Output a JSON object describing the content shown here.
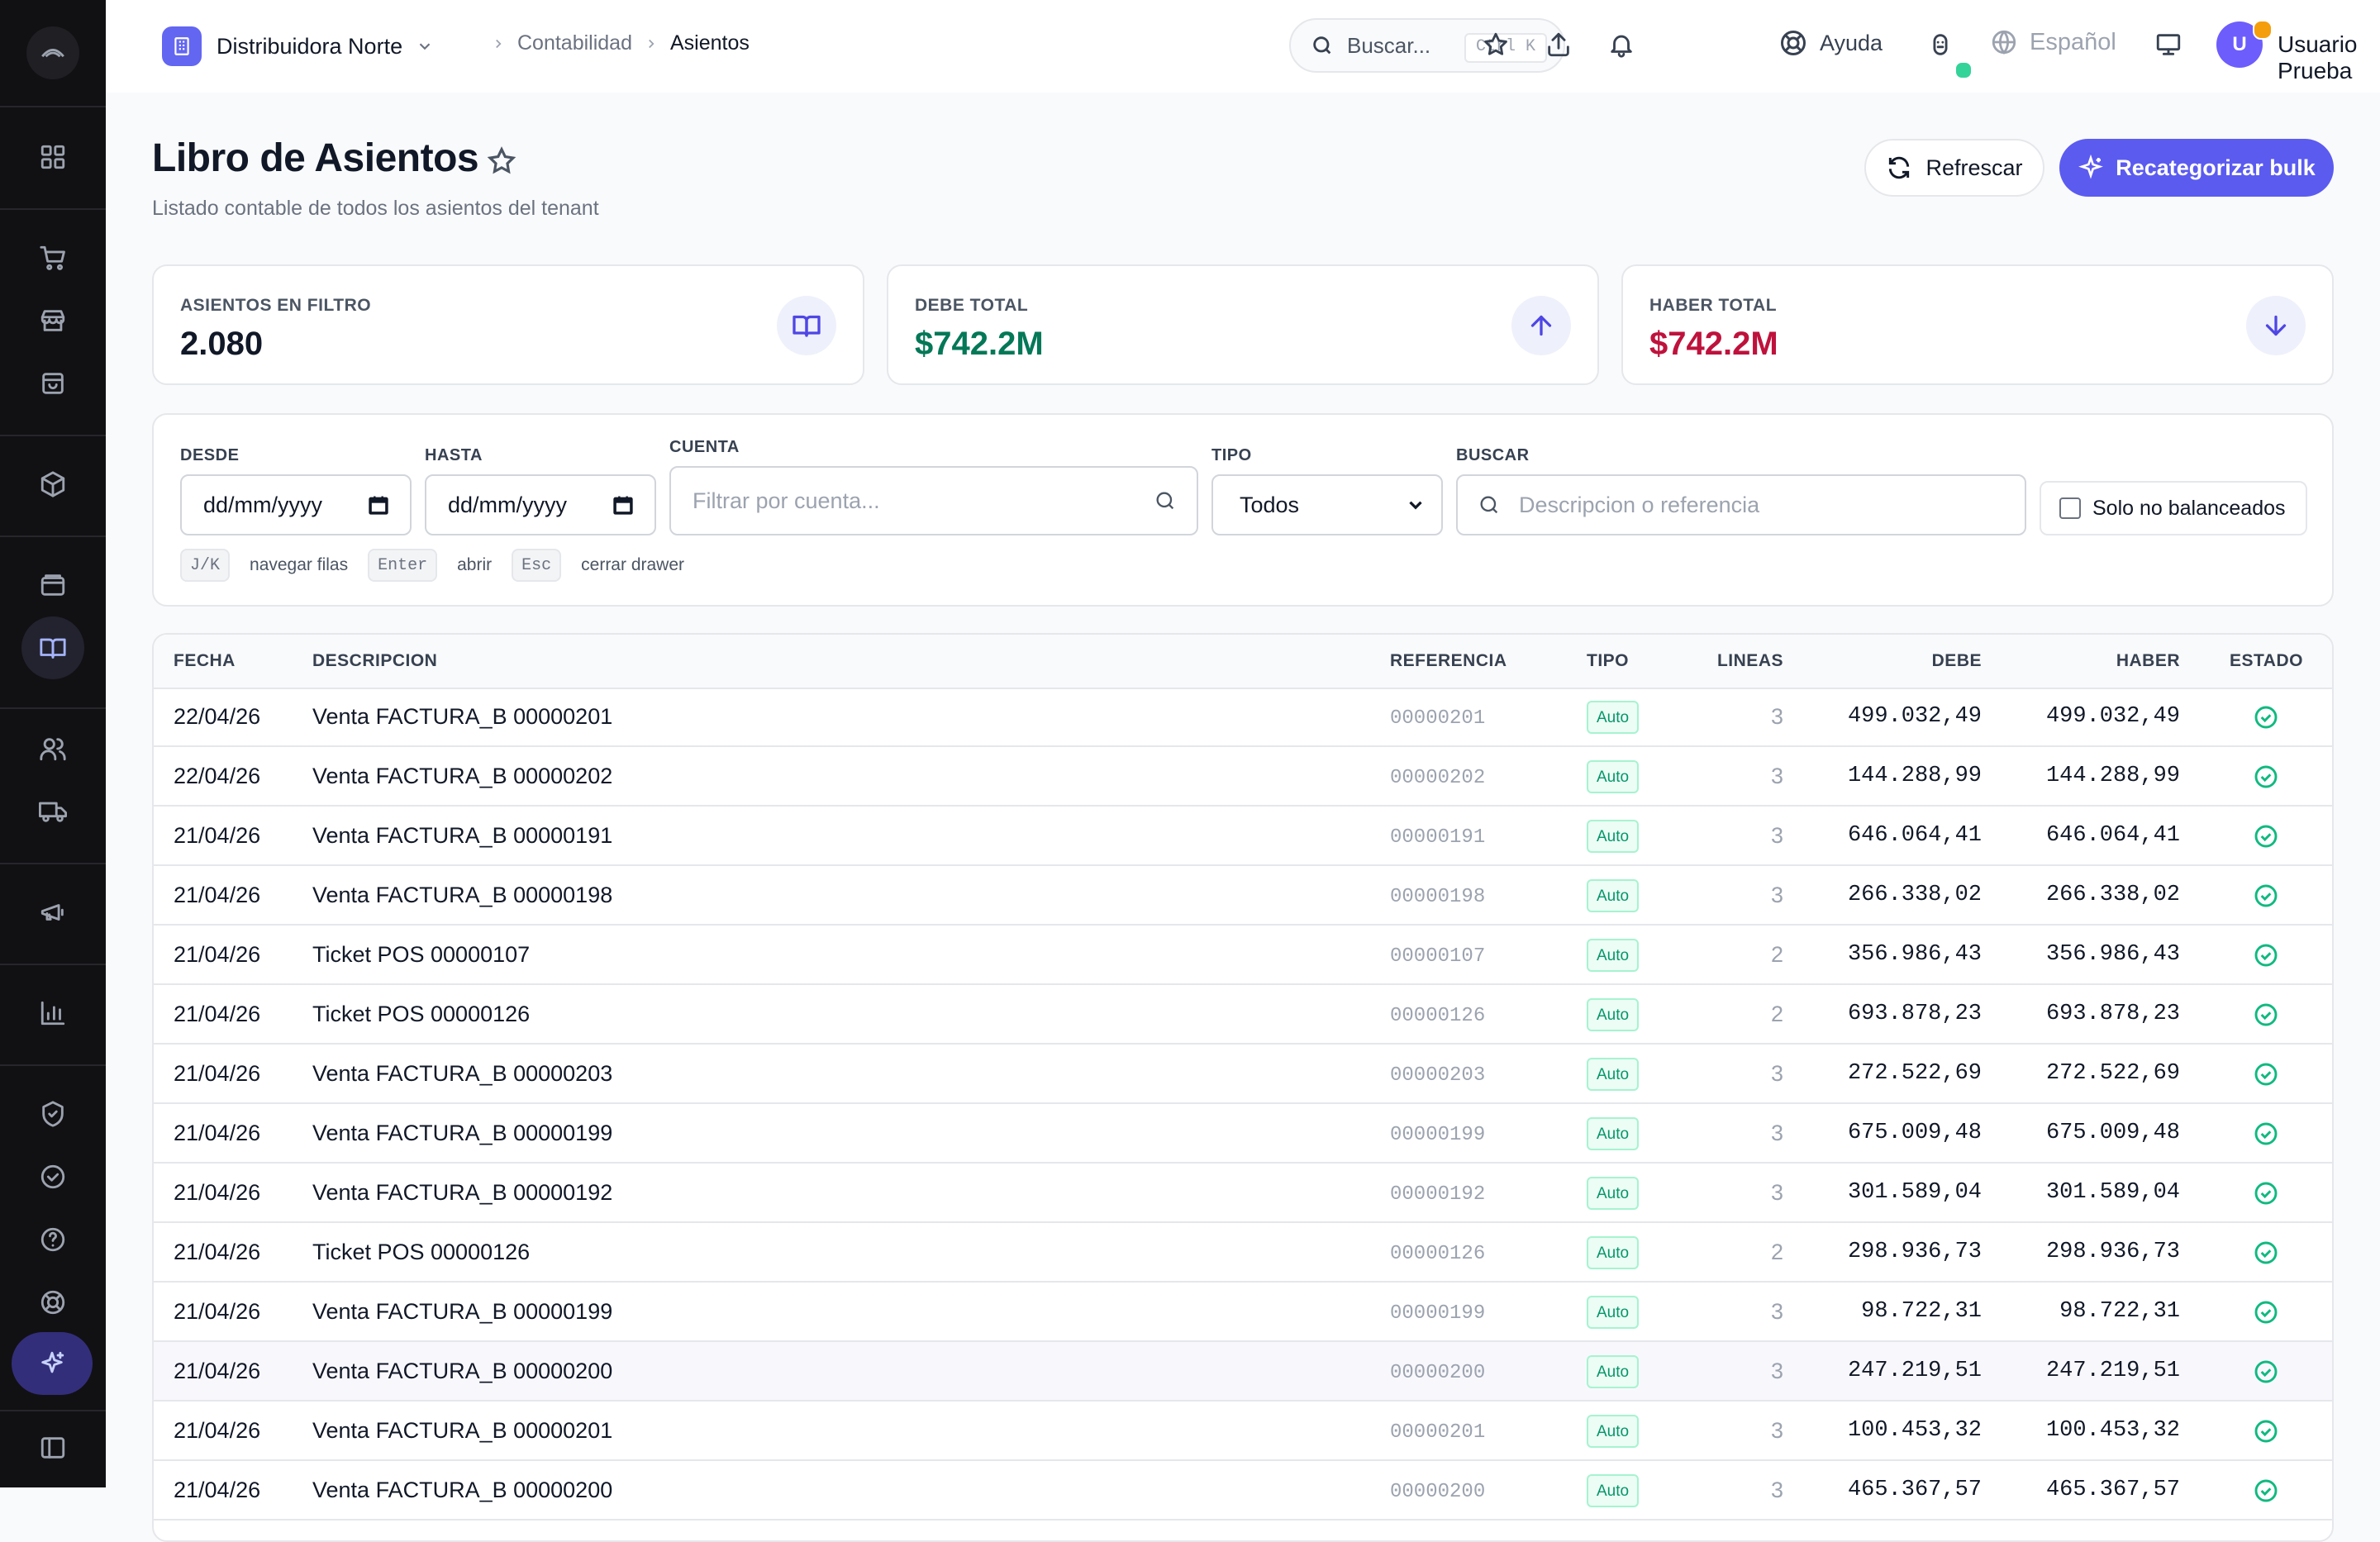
{
  "org": {
    "name": "Distribuidora Norte"
  },
  "breadcrumb": [
    "Contabilidad",
    "Asientos"
  ],
  "search": {
    "placeholder": "Buscar...",
    "shortcut": "Ctrl K"
  },
  "header": {
    "help_label": "Ayuda",
    "language": "Español",
    "user_initial": "U",
    "user_name": "Usuario Prueba"
  },
  "page": {
    "title": "Libro de Asientos",
    "subtitle": "Listado contable de todos los asientos del tenant",
    "refresh_label": "Refrescar",
    "bulk_label": "Recategorizar bulk"
  },
  "stats": [
    {
      "label": "ASIENTOS EN FILTRO",
      "value": "2.080",
      "color": "#111827",
      "icon": "book-icon"
    },
    {
      "label": "DEBE TOTAL",
      "value": "$742.2M",
      "color": "#047857",
      "icon": "arrow-up-icon"
    },
    {
      "label": "HABER TOTAL",
      "value": "$742.2M",
      "color": "#be123c",
      "icon": "arrow-down-icon"
    }
  ],
  "filters": {
    "desde_label": "DESDE",
    "desde_value": "dd/mm/yyyy",
    "hasta_label": "HASTA",
    "hasta_value": "dd/mm/yyyy",
    "cuenta_label": "CUENTA",
    "cuenta_placeholder": "Filtrar por cuenta...",
    "tipo_label": "TIPO",
    "tipo_value": "Todos",
    "buscar_label": "BUSCAR",
    "buscar_placeholder": "Descripcion o referencia",
    "checkbox_label": "Solo no balanceados",
    "shortcuts": [
      {
        "key": "J/K",
        "desc": "navegar filas"
      },
      {
        "key": "Enter",
        "desc": "abrir"
      },
      {
        "key": "Esc",
        "desc": "cerrar drawer"
      }
    ]
  },
  "table": {
    "columns": [
      "FECHA",
      "DESCRIPCION",
      "REFERENCIA",
      "TIPO",
      "LINEAS",
      "DEBE",
      "HABER",
      "ESTADO"
    ],
    "rows": [
      {
        "fecha": "22/04/26",
        "desc": "Venta FACTURA_B 00000201",
        "ref": "00000201",
        "tipo": "Auto",
        "lineas": "3",
        "debe": "499.032,49",
        "haber": "499.032,49"
      },
      {
        "fecha": "22/04/26",
        "desc": "Venta FACTURA_B 00000202",
        "ref": "00000202",
        "tipo": "Auto",
        "lineas": "3",
        "debe": "144.288,99",
        "haber": "144.288,99"
      },
      {
        "fecha": "21/04/26",
        "desc": "Venta FACTURA_B 00000191",
        "ref": "00000191",
        "tipo": "Auto",
        "lineas": "3",
        "debe": "646.064,41",
        "haber": "646.064,41"
      },
      {
        "fecha": "21/04/26",
        "desc": "Venta FACTURA_B 00000198",
        "ref": "00000198",
        "tipo": "Auto",
        "lineas": "3",
        "debe": "266.338,02",
        "haber": "266.338,02"
      },
      {
        "fecha": "21/04/26",
        "desc": "Ticket POS 00000107",
        "ref": "00000107",
        "tipo": "Auto",
        "lineas": "2",
        "debe": "356.986,43",
        "haber": "356.986,43"
      },
      {
        "fecha": "21/04/26",
        "desc": "Ticket POS 00000126",
        "ref": "00000126",
        "tipo": "Auto",
        "lineas": "2",
        "debe": "693.878,23",
        "haber": "693.878,23"
      },
      {
        "fecha": "21/04/26",
        "desc": "Venta FACTURA_B 00000203",
        "ref": "00000203",
        "tipo": "Auto",
        "lineas": "3",
        "debe": "272.522,69",
        "haber": "272.522,69"
      },
      {
        "fecha": "21/04/26",
        "desc": "Venta FACTURA_B 00000199",
        "ref": "00000199",
        "tipo": "Auto",
        "lineas": "3",
        "debe": "675.009,48",
        "haber": "675.009,48"
      },
      {
        "fecha": "21/04/26",
        "desc": "Venta FACTURA_B 00000192",
        "ref": "00000192",
        "tipo": "Auto",
        "lineas": "3",
        "debe": "301.589,04",
        "haber": "301.589,04"
      },
      {
        "fecha": "21/04/26",
        "desc": "Ticket POS 00000126",
        "ref": "00000126",
        "tipo": "Auto",
        "lineas": "2",
        "debe": "298.936,73",
        "haber": "298.936,73"
      },
      {
        "fecha": "21/04/26",
        "desc": "Venta FACTURA_B 00000199",
        "ref": "00000199",
        "tipo": "Auto",
        "lineas": "3",
        "debe": "98.722,31",
        "haber": "98.722,31"
      },
      {
        "fecha": "21/04/26",
        "desc": "Venta FACTURA_B 00000200",
        "ref": "00000200",
        "tipo": "Auto",
        "lineas": "3",
        "debe": "247.219,51",
        "haber": "247.219,51"
      },
      {
        "fecha": "21/04/26",
        "desc": "Venta FACTURA_B 00000201",
        "ref": "00000201",
        "tipo": "Auto",
        "lineas": "3",
        "debe": "100.453,32",
        "haber": "100.453,32"
      },
      {
        "fecha": "21/04/26",
        "desc": "Venta FACTURA_B 00000200",
        "ref": "00000200",
        "tipo": "Auto",
        "lineas": "3",
        "debe": "465.367,57",
        "haber": "465.367,57"
      }
    ]
  }
}
